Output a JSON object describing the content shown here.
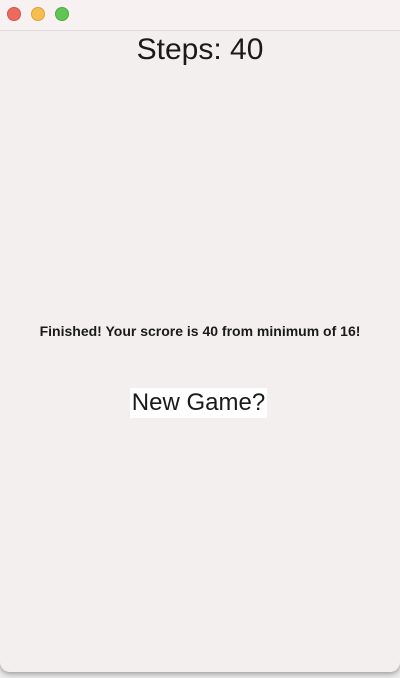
{
  "window": {
    "controls": {
      "close_color": "#ee6a5e",
      "minimize_color": "#f5be4f",
      "zoom_color": "#61c554"
    }
  },
  "game": {
    "steps_label": "Steps:",
    "steps_value": "40",
    "result_message": "Finished! Your scrore is 40 from minimum of 16!",
    "new_game_label": "New Game?"
  }
}
